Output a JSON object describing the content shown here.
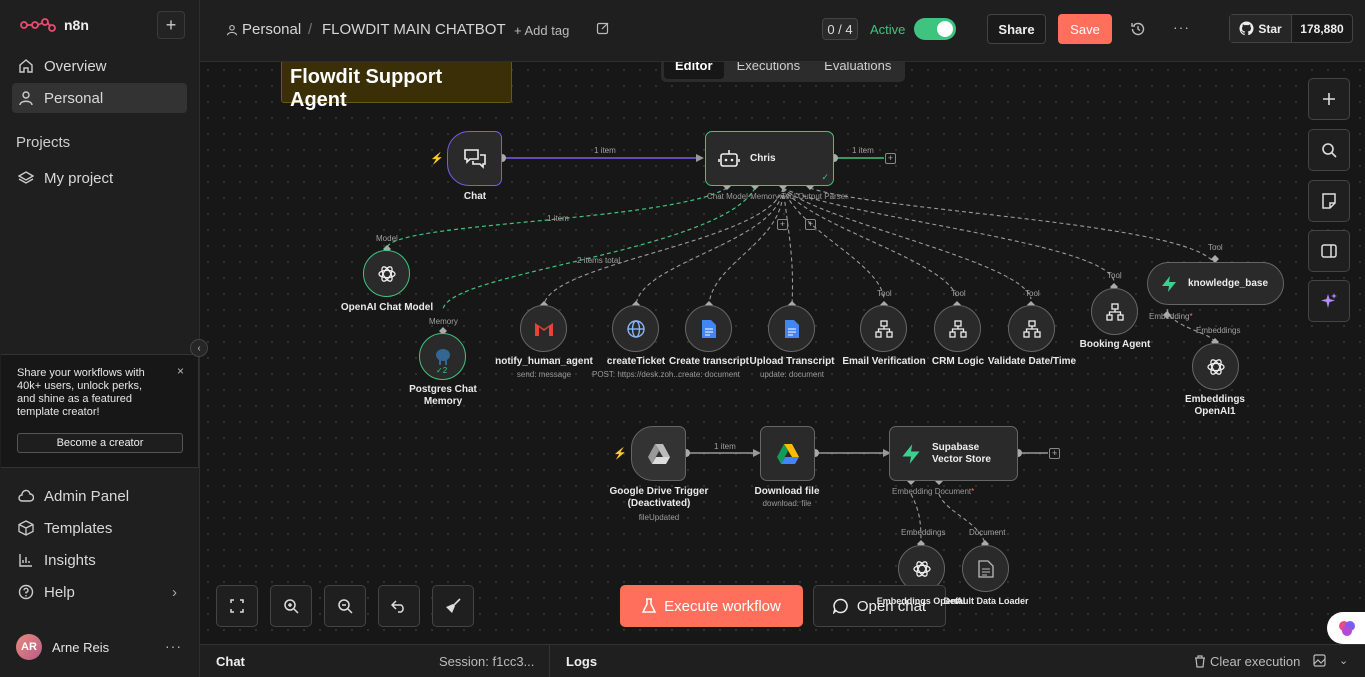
{
  "app": {
    "name": "n8n"
  },
  "sidebar": {
    "nav": [
      {
        "label": "Overview"
      },
      {
        "label": "Personal"
      }
    ],
    "projects_title": "Projects",
    "projects": [
      {
        "label": "My project"
      }
    ],
    "promo": {
      "text": "Share your workflows with 40k+ users, unlock perks, and shine as a featured template creator!",
      "button": "Become a creator",
      "close": "×"
    },
    "bottom_nav": [
      {
        "label": "Admin Panel"
      },
      {
        "label": "Templates"
      },
      {
        "label": "Insights"
      },
      {
        "label": "Help"
      }
    ],
    "user": {
      "initials": "AR",
      "name": "Arne Reis",
      "more": "···"
    }
  },
  "header": {
    "breadcrumb_project": "Personal",
    "separator": "/",
    "workflow_name": "FLOWDIT MAIN CHATBOT",
    "add_tag": "+ Add tag",
    "counter": "0 / 4",
    "active_label": "Active",
    "share": "Share",
    "save": "Save",
    "more": "···",
    "github": {
      "star": "Star",
      "count": "178,880"
    }
  },
  "tabs": [
    {
      "label": "Editor",
      "active": true
    },
    {
      "label": "Executions",
      "active": false
    },
    {
      "label": "Evaluations",
      "active": false
    }
  ],
  "canvas": {
    "sticky_title": "Flowdit Support Agent",
    "nodes": {
      "chat": {
        "label": "Chat"
      },
      "chris": {
        "label": "Chris",
        "ports": "Chat Model   Memory     Tool   Output Parser"
      },
      "openai_model": {
        "label": "OpenAI Chat Model",
        "port": "Model"
      },
      "postgres": {
        "label": "Postgres Chat Memory",
        "port": "Memory",
        "badge": "2"
      },
      "notify": {
        "label": "notify_human_agent",
        "sub": "send: message"
      },
      "create_ticket": {
        "label": "createTicket",
        "sub": "POST: https://desk.zoh..."
      },
      "create_transcript": {
        "label": "Create transcript",
        "sub": "create: document"
      },
      "upload_transcript": {
        "label": "Upload Transcript",
        "sub": "update: document"
      },
      "email_verification": {
        "label": "Email Verification",
        "port": "Tool"
      },
      "crm_logic": {
        "label": "CRM Logic",
        "port": "Tool"
      },
      "validate_date": {
        "label": "Validate Date/Time",
        "port": "Tool"
      },
      "booking_agent": {
        "label": "Booking Agent",
        "port": "Tool"
      },
      "knowledge_base": {
        "label": "knowledge_base",
        "port": "Tool",
        "embedding_port": "Embedding"
      },
      "embeddings_openai1": {
        "label": "Embeddings OpenAI1",
        "port": "Embeddings"
      },
      "gdrive_trigger": {
        "label": "Google Drive Trigger (Deactivated)",
        "sub": "fileUpdated"
      },
      "download_file": {
        "label": "Download file",
        "sub": "download: file"
      },
      "supabase": {
        "label": "Supabase Vector Store",
        "ports": "Embedding   Document"
      },
      "embeddings_openai": {
        "label": "Embeddings OpenAI",
        "port": "Embeddings"
      },
      "data_loader": {
        "label": "Default Data Loader",
        "port": "Document"
      }
    },
    "connections": {
      "chat_to_chris": "1 item",
      "chris_out": "1 item",
      "model_link": "1 item",
      "memory_link": "2 items total",
      "drive_to_download": "1 item"
    },
    "execute_button": "Execute workflow",
    "open_chat_button": "Open chat"
  },
  "bottom_panel": {
    "chat": "Chat",
    "session": "Session: f1cc3...",
    "logs": "Logs",
    "clear": "Clear execution"
  },
  "colors": {
    "accent": "#ff6f5c",
    "active_green": "#3ec47e",
    "chat_purple": "#7a5cf0"
  }
}
